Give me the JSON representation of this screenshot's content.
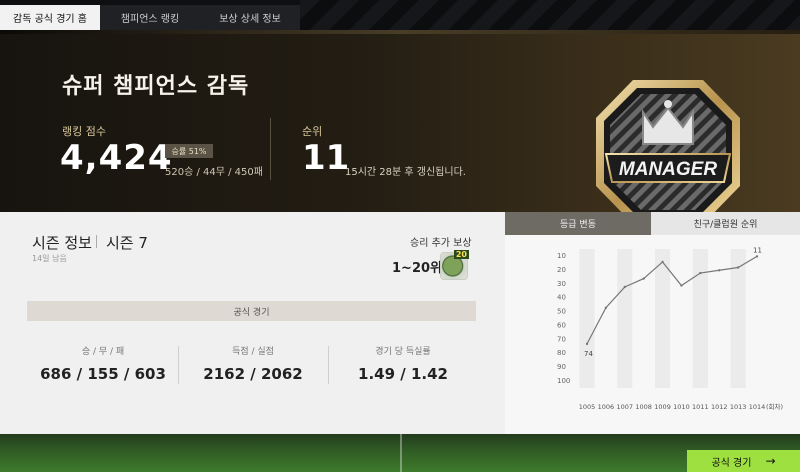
{
  "tabs": [
    "감독 공식 경기 홈",
    "챔피언스 랭킹",
    "보상 상세 정보"
  ],
  "hero": {
    "title": "슈퍼 챔피언스 감독",
    "rank_label": "랭킹 점수",
    "rank_score": "4,424",
    "win_rate": "승률 51%",
    "record": "520승 / 44무 / 450패",
    "position_label": "순위",
    "position_value": "11",
    "update_note": "15시간 28분 후 갱신됩니다.",
    "badge_text": "MANAGER"
  },
  "season": {
    "title": "시즌 정보",
    "season_name": "시즌 7",
    "days_left": "14일 남음",
    "reward_label": "승리 추가 보상",
    "reward_range": "1~20위",
    "reward_count": "20",
    "official_label": "공식 경기",
    "stats": [
      {
        "label": "승 / 무 / 패",
        "value": "686 / 155 / 603"
      },
      {
        "label": "득점 / 실점",
        "value": "2162 / 2062"
      },
      {
        "label": "경기 당 득실률",
        "value": "1.49 / 1.42"
      }
    ]
  },
  "chart_tabs": [
    "등급 변동",
    "친구/클럽원 순위"
  ],
  "chart_data": {
    "type": "line",
    "x": [
      "1005",
      "1006",
      "1007",
      "1008",
      "1009",
      "1010",
      "1011",
      "1012",
      "1013",
      "1014"
    ],
    "xunit": "(회차)",
    "values": [
      74,
      48,
      33,
      27,
      15,
      32,
      23,
      21,
      19,
      11
    ],
    "yticks": [
      10,
      20,
      30,
      40,
      50,
      60,
      70,
      80,
      90,
      100
    ],
    "ylim": [
      10,
      100
    ],
    "inverted_y": true,
    "point_labels": {
      "first": "74",
      "last": "11"
    },
    "colors": {
      "line": "#777777",
      "band": "#ebebeb"
    }
  },
  "bottom_button": {
    "label": "공식 경기",
    "arrow": "→"
  },
  "colors": {
    "accent": "#9ee03f",
    "hero_gold": "#d9c99a"
  }
}
